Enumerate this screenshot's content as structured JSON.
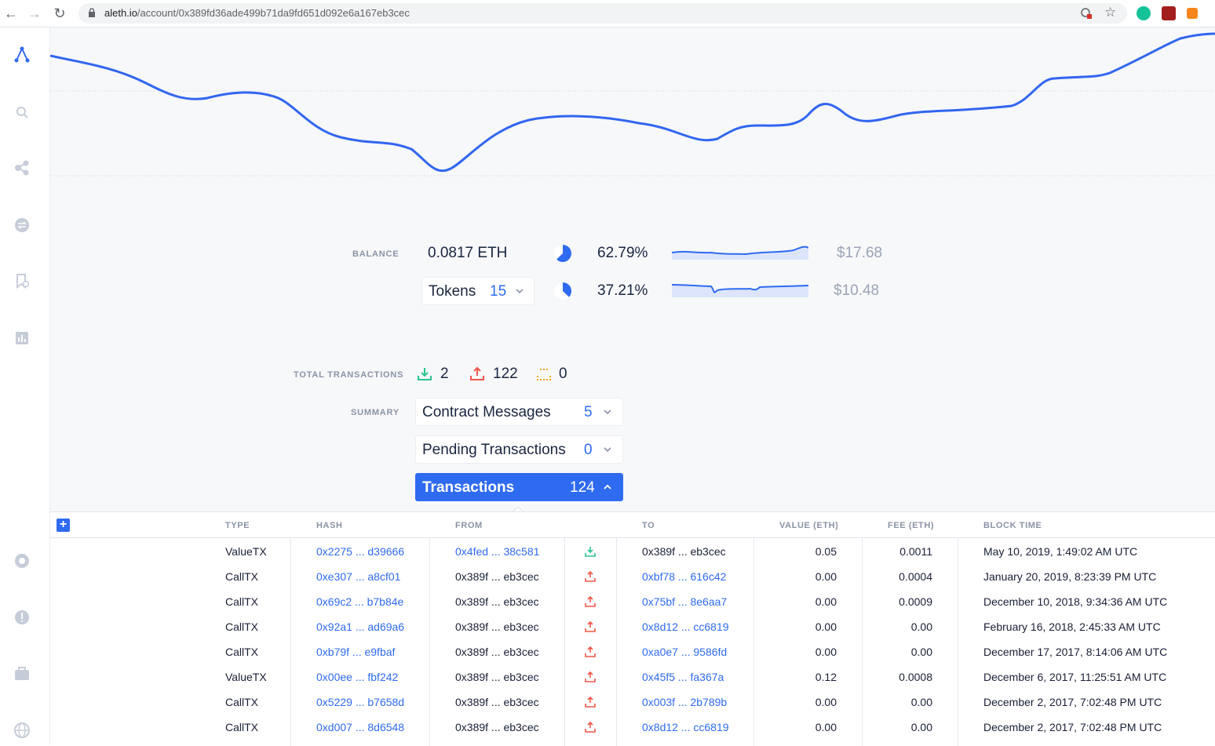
{
  "browser": {
    "url_host": "aleth.io",
    "url_path": "/account/0x389fd36ade499b71da9fd651d092e6a167eb3cec"
  },
  "summary": {
    "balance_label": "BALANCE",
    "balance_eth": "0.0817 ETH",
    "eth_percent": "62.79%",
    "eth_share": 0.6279,
    "eth_usd": "$17.68",
    "tokens_label": "Tokens",
    "tokens_count": "15",
    "tokens_percent": "37.21%",
    "tokens_share": 0.3721,
    "tokens_usd": "$10.48",
    "total_tx_label": "TOTAL TRANSACTIONS",
    "incoming_count": "2",
    "outgoing_count": "122",
    "pending_count": "0",
    "summary_label": "SUMMARY",
    "contract_messages_label": "Contract Messages",
    "contract_messages_count": "5",
    "pending_tx_label": "Pending Transactions",
    "pending_tx_count": "0",
    "transactions_label": "Transactions",
    "transactions_count": "124"
  },
  "table": {
    "headers": {
      "type": "TYPE",
      "hash": "HASH",
      "from": "FROM",
      "to": "TO",
      "value": "VALUE (ETH)",
      "fee": "FEE (ETH)",
      "block_time": "BLOCK TIME"
    },
    "rows": [
      {
        "type": "ValueTX",
        "hash": "0x2275 ... d39666",
        "from": "0x4fed ... 38c581",
        "from_link": true,
        "dir": "in",
        "to": "0x389f ... eb3cec",
        "to_link": false,
        "value": "0.05",
        "fee": "0.0011",
        "time": "May 10, 2019, 1:49:02 AM UTC"
      },
      {
        "type": "CallTX",
        "hash": "0xe307 ... a8cf01",
        "from": "0x389f ... eb3cec",
        "from_link": false,
        "dir": "out",
        "to": "0xbf78 ... 616c42",
        "to_link": true,
        "value": "0.00",
        "fee": "0.0004",
        "time": "January 20, 2019, 8:23:39 PM UTC"
      },
      {
        "type": "CallTX",
        "hash": "0x69c2 ... b7b84e",
        "from": "0x389f ... eb3cec",
        "from_link": false,
        "dir": "out",
        "to": "0x75bf ... 8e6aa7",
        "to_link": true,
        "value": "0.00",
        "fee": "0.0009",
        "time": "December 10, 2018, 9:34:36 AM UTC"
      },
      {
        "type": "CallTX",
        "hash": "0x92a1 ... ad69a6",
        "from": "0x389f ... eb3cec",
        "from_link": false,
        "dir": "out",
        "to": "0x8d12 ... cc6819",
        "to_link": true,
        "value": "0.00",
        "fee": "0.00",
        "time": "February 16, 2018, 2:45:33 AM UTC"
      },
      {
        "type": "CallTX",
        "hash": "0xb79f ... e9fbaf",
        "from": "0x389f ... eb3cec",
        "from_link": false,
        "dir": "out",
        "to": "0xa0e7 ... 9586fd",
        "to_link": true,
        "value": "0.00",
        "fee": "0.00",
        "time": "December 17, 2017, 8:14:06 AM UTC"
      },
      {
        "type": "ValueTX",
        "hash": "0x00ee ... fbf242",
        "from": "0x389f ... eb3cec",
        "from_link": false,
        "dir": "out",
        "to": "0x45f5 ... fa367a",
        "to_link": true,
        "value": "0.12",
        "fee": "0.0008",
        "time": "December 6, 2017, 11:25:51 AM UTC"
      },
      {
        "type": "CallTX",
        "hash": "0x5229 ... b7658d",
        "from": "0x389f ... eb3cec",
        "from_link": false,
        "dir": "out",
        "to": "0x003f ... 2b789b",
        "to_link": true,
        "value": "0.00",
        "fee": "0.00",
        "time": "December 2, 2017, 7:02:48 PM UTC"
      },
      {
        "type": "CallTX",
        "hash": "0xd007 ... 8d6548",
        "from": "0x389f ... eb3cec",
        "from_link": false,
        "dir": "out",
        "to": "0x8d12 ... cc6819",
        "to_link": true,
        "value": "0.00",
        "fee": "0.00",
        "time": "December 2, 2017, 7:02:48 PM UTC"
      }
    ]
  },
  "colors": {
    "accent": "#2f6bf0",
    "incoming": "#2bc48a",
    "outgoing": "#f0564a",
    "pending": "#f5a623"
  }
}
